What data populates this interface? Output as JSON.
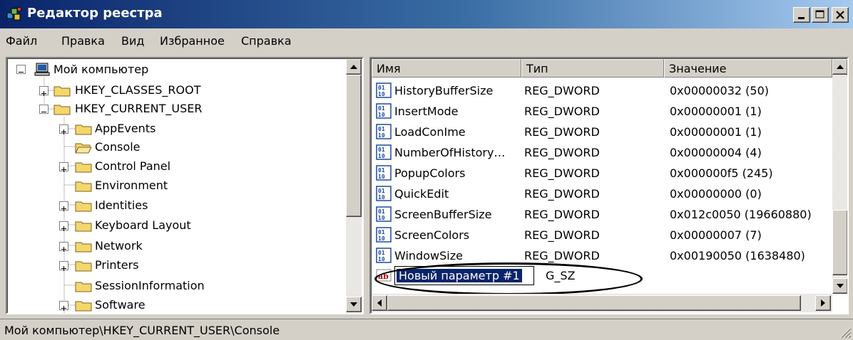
{
  "window": {
    "title": "Редактор реестра",
    "buttons": {
      "minimize": "_",
      "maximize": "□",
      "close": "×"
    }
  },
  "menu": [
    "Файл",
    "Правка",
    "Вид",
    "Избранное",
    "Справка"
  ],
  "tree": {
    "root": "Мой компьютер",
    "items": [
      "HKEY_CLASSES_ROOT",
      "HKEY_CURRENT_USER",
      "AppEvents",
      "Console",
      "Control Panel",
      "Environment",
      "Identities",
      "Keyboard Layout",
      "Network",
      "Printers",
      "SessionInformation",
      "Software"
    ]
  },
  "list": {
    "columns": [
      "Имя",
      "Тип",
      "Значение"
    ],
    "rows": [
      {
        "name": "HistoryBufferSize",
        "type": "REG_DWORD",
        "value": "0x00000032 (50)"
      },
      {
        "name": "InsertMode",
        "type": "REG_DWORD",
        "value": "0x00000001 (1)"
      },
      {
        "name": "LoadConIme",
        "type": "REG_DWORD",
        "value": "0x00000001 (1)"
      },
      {
        "name": "NumberOfHistory…",
        "type": "REG_DWORD",
        "value": "0x00000004 (4)"
      },
      {
        "name": "PopupColors",
        "type": "REG_DWORD",
        "value": "0x000000f5 (245)"
      },
      {
        "name": "QuickEdit",
        "type": "REG_DWORD",
        "value": "0x00000000 (0)"
      },
      {
        "name": "ScreenBufferSize",
        "type": "REG_DWORD",
        "value": "0x012c0050 (19660880)"
      },
      {
        "name": "ScreenColors",
        "type": "REG_DWORD",
        "value": "0x00000007 (7)"
      },
      {
        "name": "WindowSize",
        "type": "REG_DWORD",
        "value": "0x00190050 (1638480)"
      }
    ],
    "new_entry": {
      "name": "Новый параметр #1",
      "type_visible": "G_SZ"
    }
  },
  "status": "Мой компьютер\\HKEY_CURRENT_USER\\Console",
  "colors": {
    "title_start": "#0a246a",
    "title_end": "#a6caf0",
    "selection": "#0a246a",
    "face": "#d4d0c8"
  }
}
